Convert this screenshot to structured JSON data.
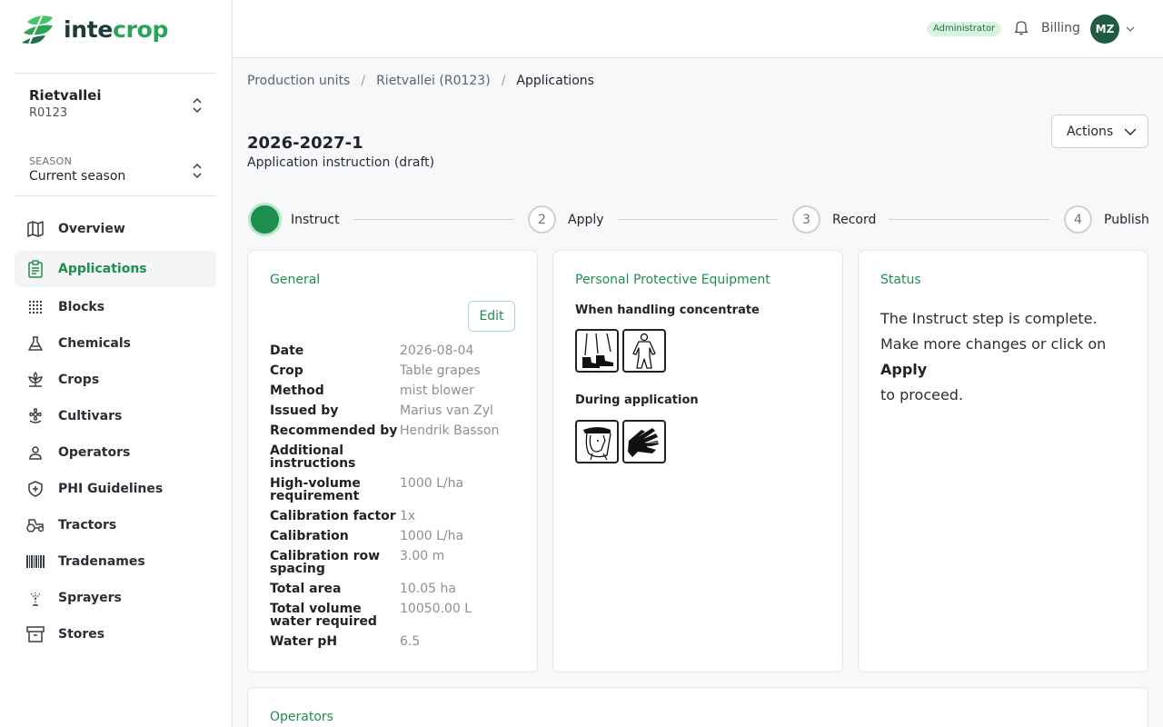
{
  "brand": {
    "part1": "inte",
    "part2": "crop"
  },
  "farm": {
    "name": "Rietvallei",
    "code": "R0123"
  },
  "season": {
    "label": "SEASON",
    "value": "Current season"
  },
  "nav": [
    {
      "label": "Overview",
      "icon": "map-icon"
    },
    {
      "label": "Applications",
      "icon": "clipboard-icon"
    },
    {
      "label": "Blocks",
      "icon": "grid-dots-icon"
    },
    {
      "label": "Chemicals",
      "icon": "flask-icon"
    },
    {
      "label": "Crops",
      "icon": "plant-icon"
    },
    {
      "label": "Cultivars",
      "icon": "flower-icon"
    },
    {
      "label": "Operators",
      "icon": "user-icon"
    },
    {
      "label": "PHI Guidelines",
      "icon": "shield-plus-icon"
    },
    {
      "label": "Tractors",
      "icon": "tractor-icon"
    },
    {
      "label": "Tradenames",
      "icon": "barcode-icon"
    },
    {
      "label": "Sprayers",
      "icon": "sprayer-icon"
    },
    {
      "label": "Stores",
      "icon": "archive-icon"
    }
  ],
  "topbar": {
    "badge": "Administrator",
    "billing": "Billing",
    "avatar": "MZ"
  },
  "breadcrumb": [
    "Production units",
    "Rietvallei (R0123)",
    "Applications"
  ],
  "page": {
    "title": "2026-2027-1",
    "subtitle": "Application instruction (draft)",
    "actions": "Actions"
  },
  "steps": [
    {
      "num": "1",
      "label": "Instruct"
    },
    {
      "num": "2",
      "label": "Apply"
    },
    {
      "num": "3",
      "label": "Record"
    },
    {
      "num": "4",
      "label": "Publish"
    }
  ],
  "general": {
    "title": "General",
    "edit": "Edit",
    "rows": [
      {
        "k1": "Date",
        "v": "2026-08-04"
      },
      {
        "k1": "Crop",
        "v": "Table grapes"
      },
      {
        "k1": "Method",
        "v": "mist blower"
      },
      {
        "k1": "Issued by",
        "v": "Marius van Zyl"
      },
      {
        "k1": "Recommended by",
        "v": "Hendrik Basson"
      },
      {
        "k1": "Additional",
        "k2": "instructions",
        "v": ""
      },
      {
        "k1": "High-volume",
        "k2": "requirement",
        "v": "1000 L/ha"
      },
      {
        "k1": "Calibration factor",
        "v": "1x"
      },
      {
        "k1": "Calibration",
        "v": "1000 L/ha"
      },
      {
        "k1": "Calibration row",
        "k2": "spacing",
        "v": "3.00 m"
      },
      {
        "k1": "Total area",
        "v": "10.05 ha"
      },
      {
        "k1": "Total volume",
        "k2": "water required",
        "v": "10050.00 L"
      },
      {
        "k1": "Water pH",
        "v": "6.5"
      }
    ]
  },
  "ppe": {
    "title": "Personal Protective Equipment",
    "concentrate_label": "When handling concentrate",
    "concentrate_icons": [
      "boots-icon",
      "overalls-icon"
    ],
    "application_label": "During application",
    "application_icons": [
      "face-shield-icon",
      "gloves-icon"
    ]
  },
  "status": {
    "title": "Status",
    "text1": "The Instruct step is complete. Make more changes or click on",
    "action": "Apply",
    "text2": "to proceed."
  },
  "operators": {
    "title": "Operators"
  },
  "colors": {
    "accent": "#1e8e4f",
    "brand_dark": "#1d3d34",
    "brand_green": "#27a35a"
  }
}
